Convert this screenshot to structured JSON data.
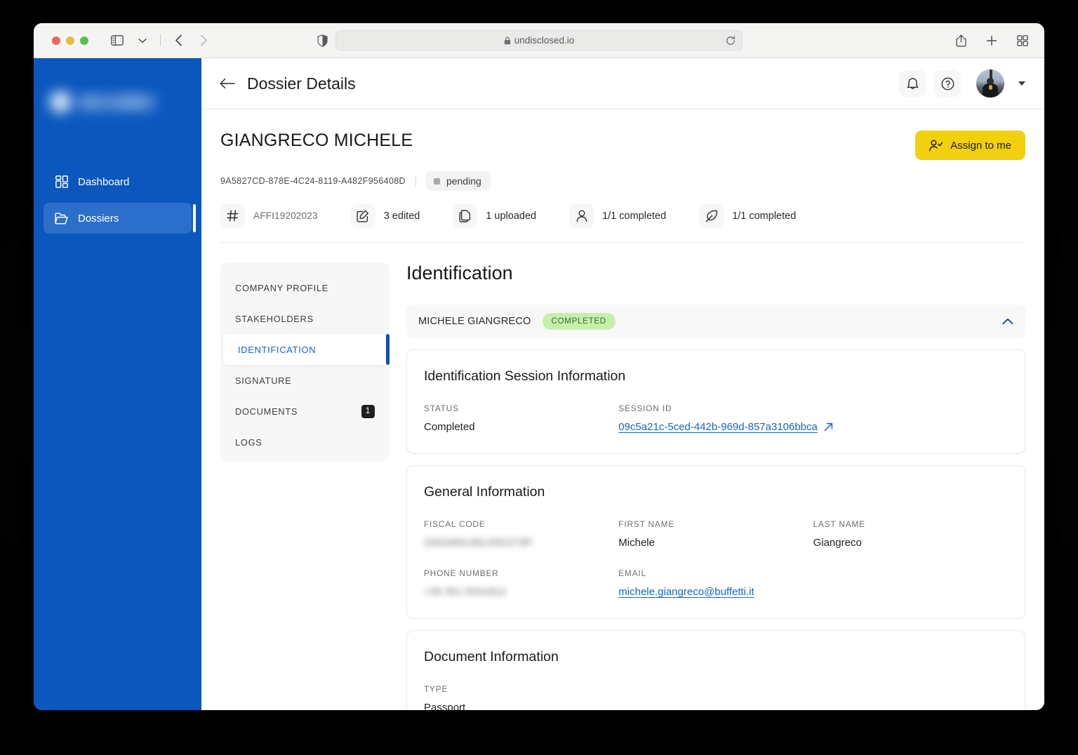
{
  "browser": {
    "url": "undisclosed.io",
    "lock_icon": "lock-icon",
    "shield_icon": "shield-icon",
    "reload_icon": "reload-icon",
    "sidebar_toggle_icon": "sidebar-toggle-icon",
    "back_icon": "back-arrow-icon",
    "forward_icon": "forward-arrow-icon",
    "share_icon": "share-icon",
    "new_tab_icon": "plus-icon",
    "tab_overview_icon": "tab-grid-icon"
  },
  "sidebar": {
    "logo_alt": "company-logo-redacted",
    "items": [
      {
        "label": "Dashboard",
        "icon": "grid-icon",
        "active": false
      },
      {
        "label": "Dossiers",
        "icon": "folder-icon",
        "active": true
      }
    ]
  },
  "topbar": {
    "title": "Dossier Details",
    "back_icon": "arrow-left-icon",
    "notifications_icon": "bell-icon",
    "help_icon": "question-circle-icon",
    "avatar_alt": "user-avatar",
    "caret_icon": "caret-down-icon"
  },
  "dossier": {
    "name": "GIANGRECO MICHELE",
    "uuid": "9A5827CD-878E-4C24-8119-A482F956408D",
    "status": "pending",
    "assign_button": "Assign to me",
    "assign_icon": "user-check-icon",
    "metrics": [
      {
        "icon": "hash-icon",
        "label": "AFFI19202023",
        "muted": true
      },
      {
        "icon": "edit-square-icon",
        "label": "3 edited",
        "muted": false
      },
      {
        "icon": "copy-icon",
        "label": "1 uploaded",
        "muted": false
      },
      {
        "icon": "person-icon",
        "label": "1/1 completed",
        "muted": false
      },
      {
        "icon": "feather-pen-icon",
        "label": "1/1 completed",
        "muted": false
      }
    ]
  },
  "section_nav": {
    "items": [
      {
        "label": "COMPANY PROFILE",
        "active": false,
        "badge": null
      },
      {
        "label": "STAKEHOLDERS",
        "active": false,
        "badge": null
      },
      {
        "label": "IDENTIFICATION",
        "active": true,
        "badge": null
      },
      {
        "label": "SIGNATURE",
        "active": false,
        "badge": null
      },
      {
        "label": "DOCUMENTS",
        "active": false,
        "badge": "1"
      },
      {
        "label": "LOGS",
        "active": false,
        "badge": null
      }
    ]
  },
  "panel": {
    "title": "Identification",
    "accordion": {
      "name": "MICHELE GIANGRECO",
      "badge": "COMPLETED",
      "chevron_icon": "chevron-up-icon"
    },
    "session_card": {
      "title": "Identification Session Information",
      "status_label": "STATUS",
      "status_value": "Completed",
      "session_id_label": "SESSION ID",
      "session_id_value": "09c5a21c-5ced-442b-969d-857a3106bbca",
      "external_link_icon": "external-link-icon"
    },
    "general_card": {
      "title": "General Information",
      "fiscal_code_label": "FISCAL CODE",
      "fiscal_code_value": "GNGMHL85L05G273P",
      "first_name_label": "FIRST NAME",
      "first_name_value": "Michele",
      "last_name_label": "LAST NAME",
      "last_name_value": "Giangreco",
      "phone_label": "PHONE NUMBER",
      "phone_value": "+39 351 5041812",
      "email_label": "EMAIL",
      "email_value": "michele.giangreco@buffetti.it"
    },
    "document_card": {
      "title": "Document Information",
      "type_label": "TYPE",
      "type_value": "Passport"
    }
  },
  "colors": {
    "sidebar_blue": "#0b57bd",
    "accent_blue": "#0f64d2",
    "assign_yellow": "#f2d00d",
    "badge_green_bg": "#c6efae",
    "badge_green_text": "#2f6b28"
  }
}
